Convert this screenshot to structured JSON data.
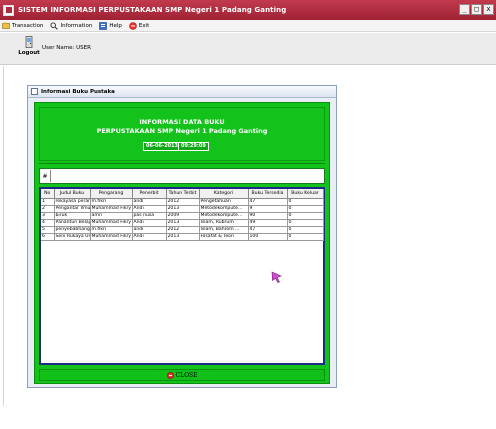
{
  "window": {
    "title": "SISTEM INFORMASI PERPUSTAKAAN SMP Negeri 1 Padang Ganting",
    "controls": [
      "_",
      "□",
      "x"
    ]
  },
  "menu": [
    {
      "label": "Transaction",
      "icon": "transaction-icon"
    },
    {
      "label": "Information",
      "icon": "magnifier-icon"
    },
    {
      "label": "Help",
      "icon": "help-icon"
    },
    {
      "label": "Exit",
      "icon": "exit-icon"
    }
  ],
  "toolbar": {
    "logout_label": "Logout",
    "user_label": "User Name: USER"
  },
  "internal_frame": {
    "title": "Informasi Buku Pustaka"
  },
  "header": {
    "line1": "INFORMASI DATA BUKU",
    "line2": "PERPUSTAKAAN SMP Negeri 1 Padang Ganting",
    "date": "06-06-2013",
    "time": "09:29:09"
  },
  "search": {
    "label": "#",
    "value": ""
  },
  "table": {
    "columns": [
      "No",
      "Judul Buku",
      "Pengarang",
      "Penerbit",
      "Tahun Terbit",
      "Kategori",
      "Buku Tersedia",
      "Buku Keluar"
    ],
    "rows": [
      [
        "1",
        "rekayasa peran...",
        "m.fikri",
        "andi",
        "2012",
        "Pengetahuan",
        "47",
        "0"
      ],
      [
        "2",
        "Pengantar Ilmu ...",
        "Muhammad Fikry",
        "Andi",
        "2013",
        "Metodekompute...",
        "9",
        "0"
      ],
      [
        "3",
        "biruk",
        "amri",
        "pas nusa",
        "2009",
        "Metodekompute...",
        "90",
        "0"
      ],
      [
        "4",
        "Panantun Belaj...",
        "Muhammad Fikry",
        "Andi",
        "2013",
        "Islam, Rubrum",
        "49",
        "0"
      ],
      [
        "5",
        "penyebabhangu...",
        "m.fikri",
        "andi",
        "2012",
        "Islam, Bahrom ...",
        "47",
        "0"
      ],
      [
        "6",
        "Seni Rukaya Un...",
        "Muhammad Fikry",
        "Andi",
        "2013",
        "Filsafat & Teori",
        "100",
        "0"
      ]
    ]
  },
  "footer": {
    "close_label": "CLOSE"
  },
  "colors": {
    "titlebar": "#b02a3c",
    "panel_green": "#12c41a",
    "table_border": "#1d2b86",
    "cursor": "#cc44cc"
  }
}
